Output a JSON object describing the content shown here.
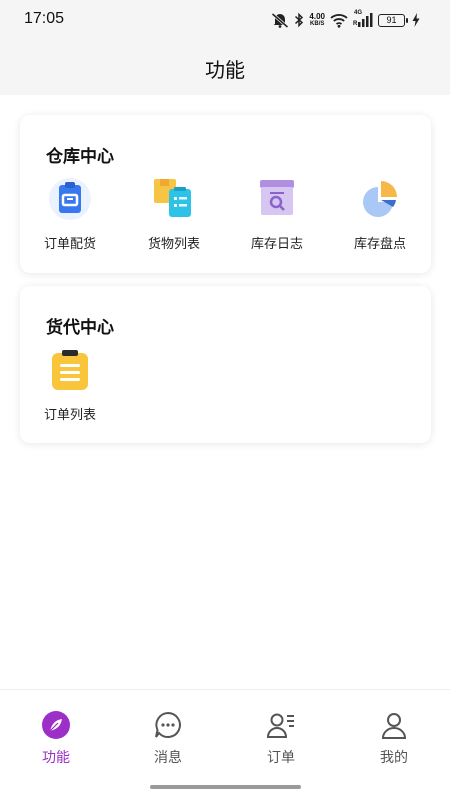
{
  "status_bar": {
    "time": "17:05",
    "net_speed_value": "4.00",
    "net_speed_unit": "KB/S",
    "network_type": "4G",
    "roaming": "R",
    "battery_level": "91"
  },
  "header": {
    "title": "功能"
  },
  "sections": [
    {
      "title": "仓库中心",
      "items": [
        {
          "label": "订单配货",
          "icon": "clipboard-icon"
        },
        {
          "label": "货物列表",
          "icon": "goods-list-icon"
        },
        {
          "label": "库存日志",
          "icon": "inventory-log-icon"
        },
        {
          "label": "库存盘点",
          "icon": "pie-chart-icon"
        }
      ]
    },
    {
      "title": "货代中心",
      "items": [
        {
          "label": "订单列表",
          "icon": "order-list-icon"
        }
      ]
    }
  ],
  "tabbar": {
    "active_color": "#9b2fc8",
    "tabs": [
      {
        "label": "功能",
        "icon": "compass-icon",
        "active": true
      },
      {
        "label": "消息",
        "icon": "message-icon",
        "active": false
      },
      {
        "label": "订单",
        "icon": "order-user-icon",
        "active": false
      },
      {
        "label": "我的",
        "icon": "profile-icon",
        "active": false
      }
    ]
  }
}
